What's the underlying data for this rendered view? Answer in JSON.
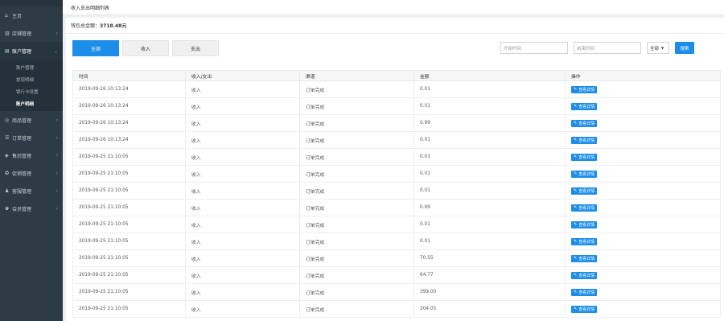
{
  "sidebar": {
    "items": [
      {
        "icon": "home-icon",
        "glyph": "⌂",
        "label": "主页",
        "chevron": false
      },
      {
        "icon": "store-icon",
        "glyph": "▥",
        "label": "店铺管理",
        "chevron": true
      },
      {
        "icon": "account-icon",
        "glyph": "▤",
        "label": "账户管理",
        "chevron": true,
        "open": true,
        "children": [
          {
            "label": "账户管理",
            "active": false
          },
          {
            "label": "提现明细",
            "active": false
          },
          {
            "label": "银行卡设置",
            "active": false
          },
          {
            "label": "账户明细",
            "active": true
          }
        ]
      },
      {
        "icon": "goods-icon",
        "glyph": "◎",
        "label": "商品管理",
        "chevron": true
      },
      {
        "icon": "order-icon",
        "glyph": "☰",
        "label": "订单管理",
        "chevron": true
      },
      {
        "icon": "aftersale-icon",
        "glyph": "◈",
        "label": "售后管理",
        "chevron": true
      },
      {
        "icon": "marketing-icon",
        "glyph": "✪",
        "label": "促销管理",
        "chevron": true
      },
      {
        "icon": "service-icon",
        "glyph": "♟",
        "label": "客服管理",
        "chevron": true
      },
      {
        "icon": "member-icon",
        "glyph": "♚",
        "label": "会员管理",
        "chevron": true
      }
    ]
  },
  "header": {
    "title": "收入支出明细列表"
  },
  "wallet": {
    "label": "钱包总金额：",
    "amount": "3718.48元"
  },
  "tabs": [
    "全部",
    "收入",
    "支出"
  ],
  "filters": {
    "start_placeholder": "开始时间",
    "end_placeholder": "结束时间",
    "type_selected": "全部",
    "search_label": "搜索"
  },
  "table": {
    "columns": [
      "时间",
      "收入/支出",
      "渠道",
      "金额",
      "操作"
    ],
    "action_label": "查看详情",
    "rows": [
      {
        "time": "2019-09-26 10:13:24",
        "type": "收入",
        "source": "订单完成",
        "amount": "0.01"
      },
      {
        "time": "2019-09-26 10:13:24",
        "type": "收入",
        "source": "订单完成",
        "amount": "0.01"
      },
      {
        "time": "2019-09-26 10:13:24",
        "type": "收入",
        "source": "订单完成",
        "amount": "0.99"
      },
      {
        "time": "2019-09-26 10:13:24",
        "type": "收入",
        "source": "订单完成",
        "amount": "0.01"
      },
      {
        "time": "2019-09-25 21:10:05",
        "type": "收入",
        "source": "订单完成",
        "amount": "0.01"
      },
      {
        "time": "2019-09-25 21:10:05",
        "type": "收入",
        "source": "订单完成",
        "amount": "0.01"
      },
      {
        "time": "2019-09-25 21:10:05",
        "type": "收入",
        "source": "订单完成",
        "amount": "0.01"
      },
      {
        "time": "2019-09-25 21:10:05",
        "type": "收入",
        "source": "订单完成",
        "amount": "0.99"
      },
      {
        "time": "2019-09-25 21:10:05",
        "type": "收入",
        "source": "订单完成",
        "amount": "0.01"
      },
      {
        "time": "2019-09-25 21:10:05",
        "type": "收入",
        "source": "订单完成",
        "amount": "0.01"
      },
      {
        "time": "2019-09-25 21:10:05",
        "type": "收入",
        "source": "订单完成",
        "amount": "70.55"
      },
      {
        "time": "2019-09-25 21:10:05",
        "type": "收入",
        "source": "订单完成",
        "amount": "64.77"
      },
      {
        "time": "2019-09-25 21:10:05",
        "type": "收入",
        "source": "订单完成",
        "amount": "399.00"
      },
      {
        "time": "2019-09-25 21:10:05",
        "type": "收入",
        "source": "订单完成",
        "amount": "204.05"
      }
    ]
  },
  "colors": {
    "accent": "#1c8de8",
    "sidebar": "#2c3b45"
  }
}
